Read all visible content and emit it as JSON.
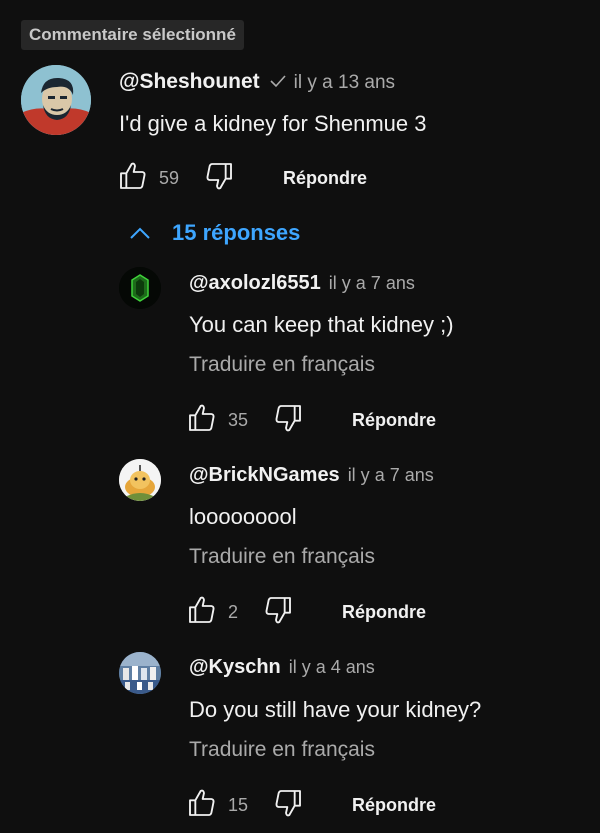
{
  "badge": "Commentaire sélectionné",
  "main_comment": {
    "handle": "@Sheshounet",
    "time": "il y a 13 ans",
    "text": "I'd give a kidney for Shenmue 3",
    "likes": "59",
    "reply_label": "Répondre"
  },
  "replies_toggle": {
    "label": "15 réponses"
  },
  "replies": [
    {
      "handle": "@axolozl6551",
      "time": "il y a 7 ans",
      "text": "You can keep that kidney ;)",
      "translate": "Traduire en français",
      "likes": "35",
      "reply_label": "Répondre"
    },
    {
      "handle": "@BrickNGames",
      "time": "il y a 7 ans",
      "text": "looooooool",
      "translate": "Traduire en français",
      "likes": "2",
      "reply_label": "Répondre"
    },
    {
      "handle": "@Kyschn",
      "time": "il y a 4 ans",
      "text": "Do you still have your kidney?",
      "translate": "Traduire en français",
      "likes": "15",
      "reply_label": "Répondre"
    }
  ],
  "colors": {
    "background": "#0f0f0f",
    "link_blue": "#3ea6ff",
    "muted": "#aaaaaa"
  },
  "icons": [
    "verified-check-icon",
    "like-icon",
    "dislike-icon",
    "chevron-up-icon"
  ]
}
